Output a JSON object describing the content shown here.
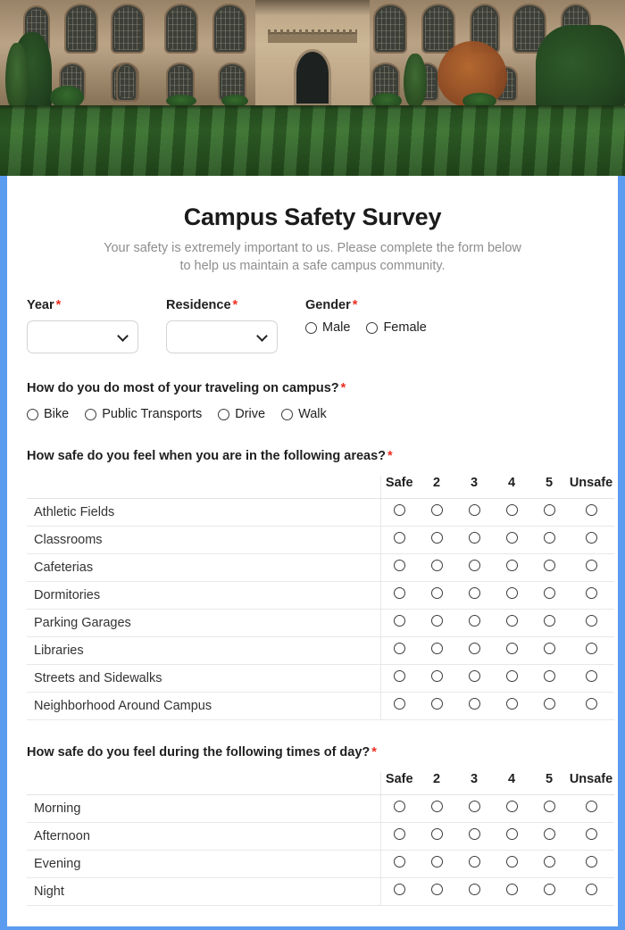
{
  "theme": {
    "frame_border_color": "#5b9bf0",
    "required_marker_color": "#ee2d20",
    "title_color": "#1b1b1b",
    "subtitle_color": "#8e8e8e",
    "card_background": "#ffffff"
  },
  "banner": {
    "alt": "campus-building-and-lawn-photo"
  },
  "header": {
    "title": "Campus Safety Survey",
    "subtitle": "Your safety is extremely important to us. Please complete the form below to help us maintain a safe campus community."
  },
  "fields": {
    "year": {
      "label": "Year",
      "required_marker": "*",
      "value": "",
      "chevron_icon": "chevron-down-icon"
    },
    "residence": {
      "label": "Residence",
      "required_marker": "*",
      "value": "",
      "chevron_icon": "chevron-down-icon"
    },
    "gender": {
      "label": "Gender",
      "required_marker": "*",
      "options": [
        "Male",
        "Female"
      ]
    }
  },
  "travel_question": {
    "text": "How do you do most of your traveling on campus?",
    "required_marker": "*",
    "options": [
      "Bike",
      "Public Transports",
      "Drive",
      "Walk"
    ]
  },
  "areas_matrix": {
    "question": "How safe do you feel when you are in the following areas?",
    "required_marker": "*",
    "scale": [
      "Safe",
      "2",
      "3",
      "4",
      "5",
      "Unsafe"
    ],
    "rows": [
      "Athletic Fields",
      "Classrooms",
      "Cafeterias",
      "Dormitories",
      "Parking Garages",
      "Libraries",
      "Streets and Sidewalks",
      "Neighborhood Around Campus"
    ]
  },
  "times_matrix": {
    "question": "How safe do you feel during the following times of day?",
    "required_marker": "*",
    "scale": [
      "Safe",
      "2",
      "3",
      "4",
      "5",
      "Unsafe"
    ],
    "rows": [
      "Morning",
      "Afternoon",
      "Evening",
      "Night"
    ]
  }
}
